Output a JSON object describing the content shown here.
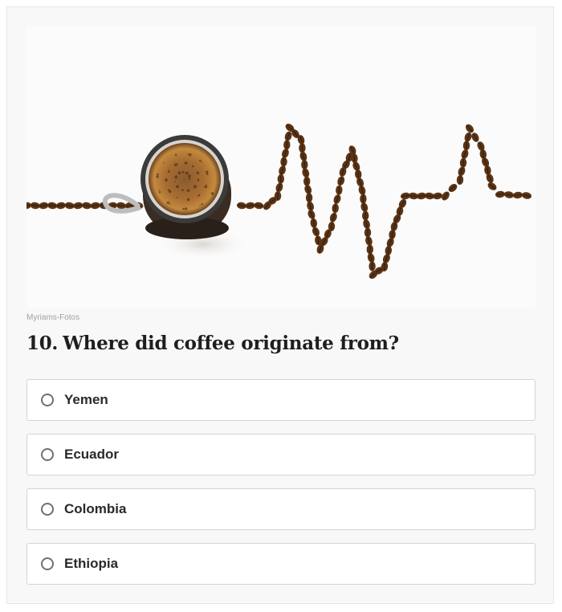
{
  "image": {
    "alt": "coffee-heartbeat-photo",
    "credit": "Myriams-Fotos"
  },
  "question": {
    "number": "10.",
    "text": "Where did coffee originate from?"
  },
  "options": [
    {
      "label": "Yemen",
      "selected": false
    },
    {
      "label": "Ecuador",
      "selected": false
    },
    {
      "label": "Colombia",
      "selected": false
    },
    {
      "label": "Ethiopia",
      "selected": false
    }
  ],
  "colors": {
    "card_background": "#f8f8f8",
    "option_border": "#d4d4d4",
    "radio_border": "#707070",
    "bean": "#5a3416"
  }
}
